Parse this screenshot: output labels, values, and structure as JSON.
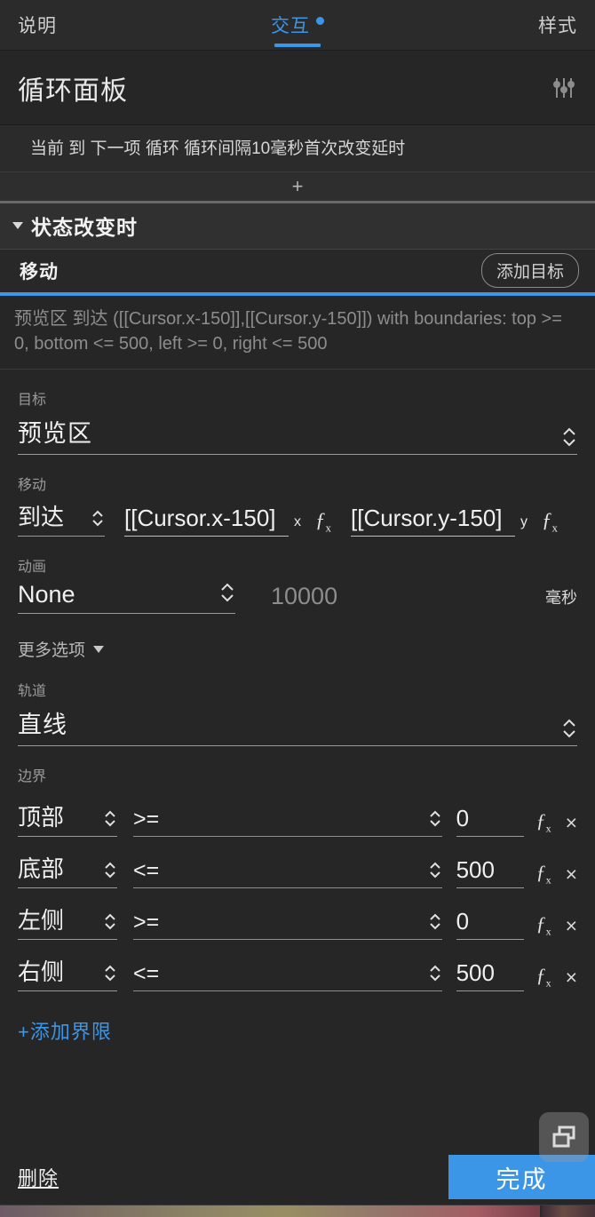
{
  "tabs": [
    {
      "label": "说明",
      "active": false,
      "has_dot": false
    },
    {
      "label": "交互",
      "active": true,
      "has_dot": true
    },
    {
      "label": "样式",
      "active": false,
      "has_dot": false
    }
  ],
  "panel": {
    "title": "循环面板",
    "settings_icon": "sliders-icon",
    "summary": "当前 到 下一项 循环 循环间隔10毫秒首次改变延时",
    "add_row_label": "+"
  },
  "state_section": {
    "title": "状态改变时",
    "caret": "caret-down-icon"
  },
  "action": {
    "title": "移动",
    "add_target_label": "添加目标",
    "description": "预览区 到达 ([[Cursor.x-150]],[[Cursor.y-150]])  with boundaries: top >= 0, bottom <= 500, left >= 0, right <= 500"
  },
  "form": {
    "target_label": "目标",
    "target_value": "预览区",
    "move_label": "移动",
    "move_mode": "到达",
    "coord_x": {
      "text": "[[Cursor.x-150]",
      "axis": "x",
      "fx": "ƒ"
    },
    "coord_y": {
      "text": "[[Cursor.y-150]",
      "axis": "y",
      "fx": "ƒ"
    },
    "anim_label": "动画",
    "anim_value": "None",
    "duration": "10000",
    "duration_unit": "毫秒",
    "more_options": "更多选项",
    "track_label": "轨道",
    "track_value": "直线",
    "boundary_label": "边界"
  },
  "boundaries": [
    {
      "side": "顶部",
      "op": ">=",
      "value": "0",
      "fx": "ƒ",
      "remove": "×"
    },
    {
      "side": "底部",
      "op": "<=",
      "value": "500",
      "fx": "ƒ",
      "remove": "×"
    },
    {
      "side": "左侧",
      "op": ">=",
      "value": "0",
      "fx": "ƒ",
      "remove": "×"
    },
    {
      "side": "右侧",
      "op": "<=",
      "value": "500",
      "fx": "ƒ",
      "remove": "×"
    }
  ],
  "add_limit_label": "+添加界限",
  "footer": {
    "delete_label": "删除",
    "done_label": "完成"
  },
  "colors": {
    "accent": "#3b96e8",
    "background": "#262626",
    "panel": "#2b2b2b",
    "text": "#f0f0f0",
    "muted": "#8d8d8d"
  }
}
